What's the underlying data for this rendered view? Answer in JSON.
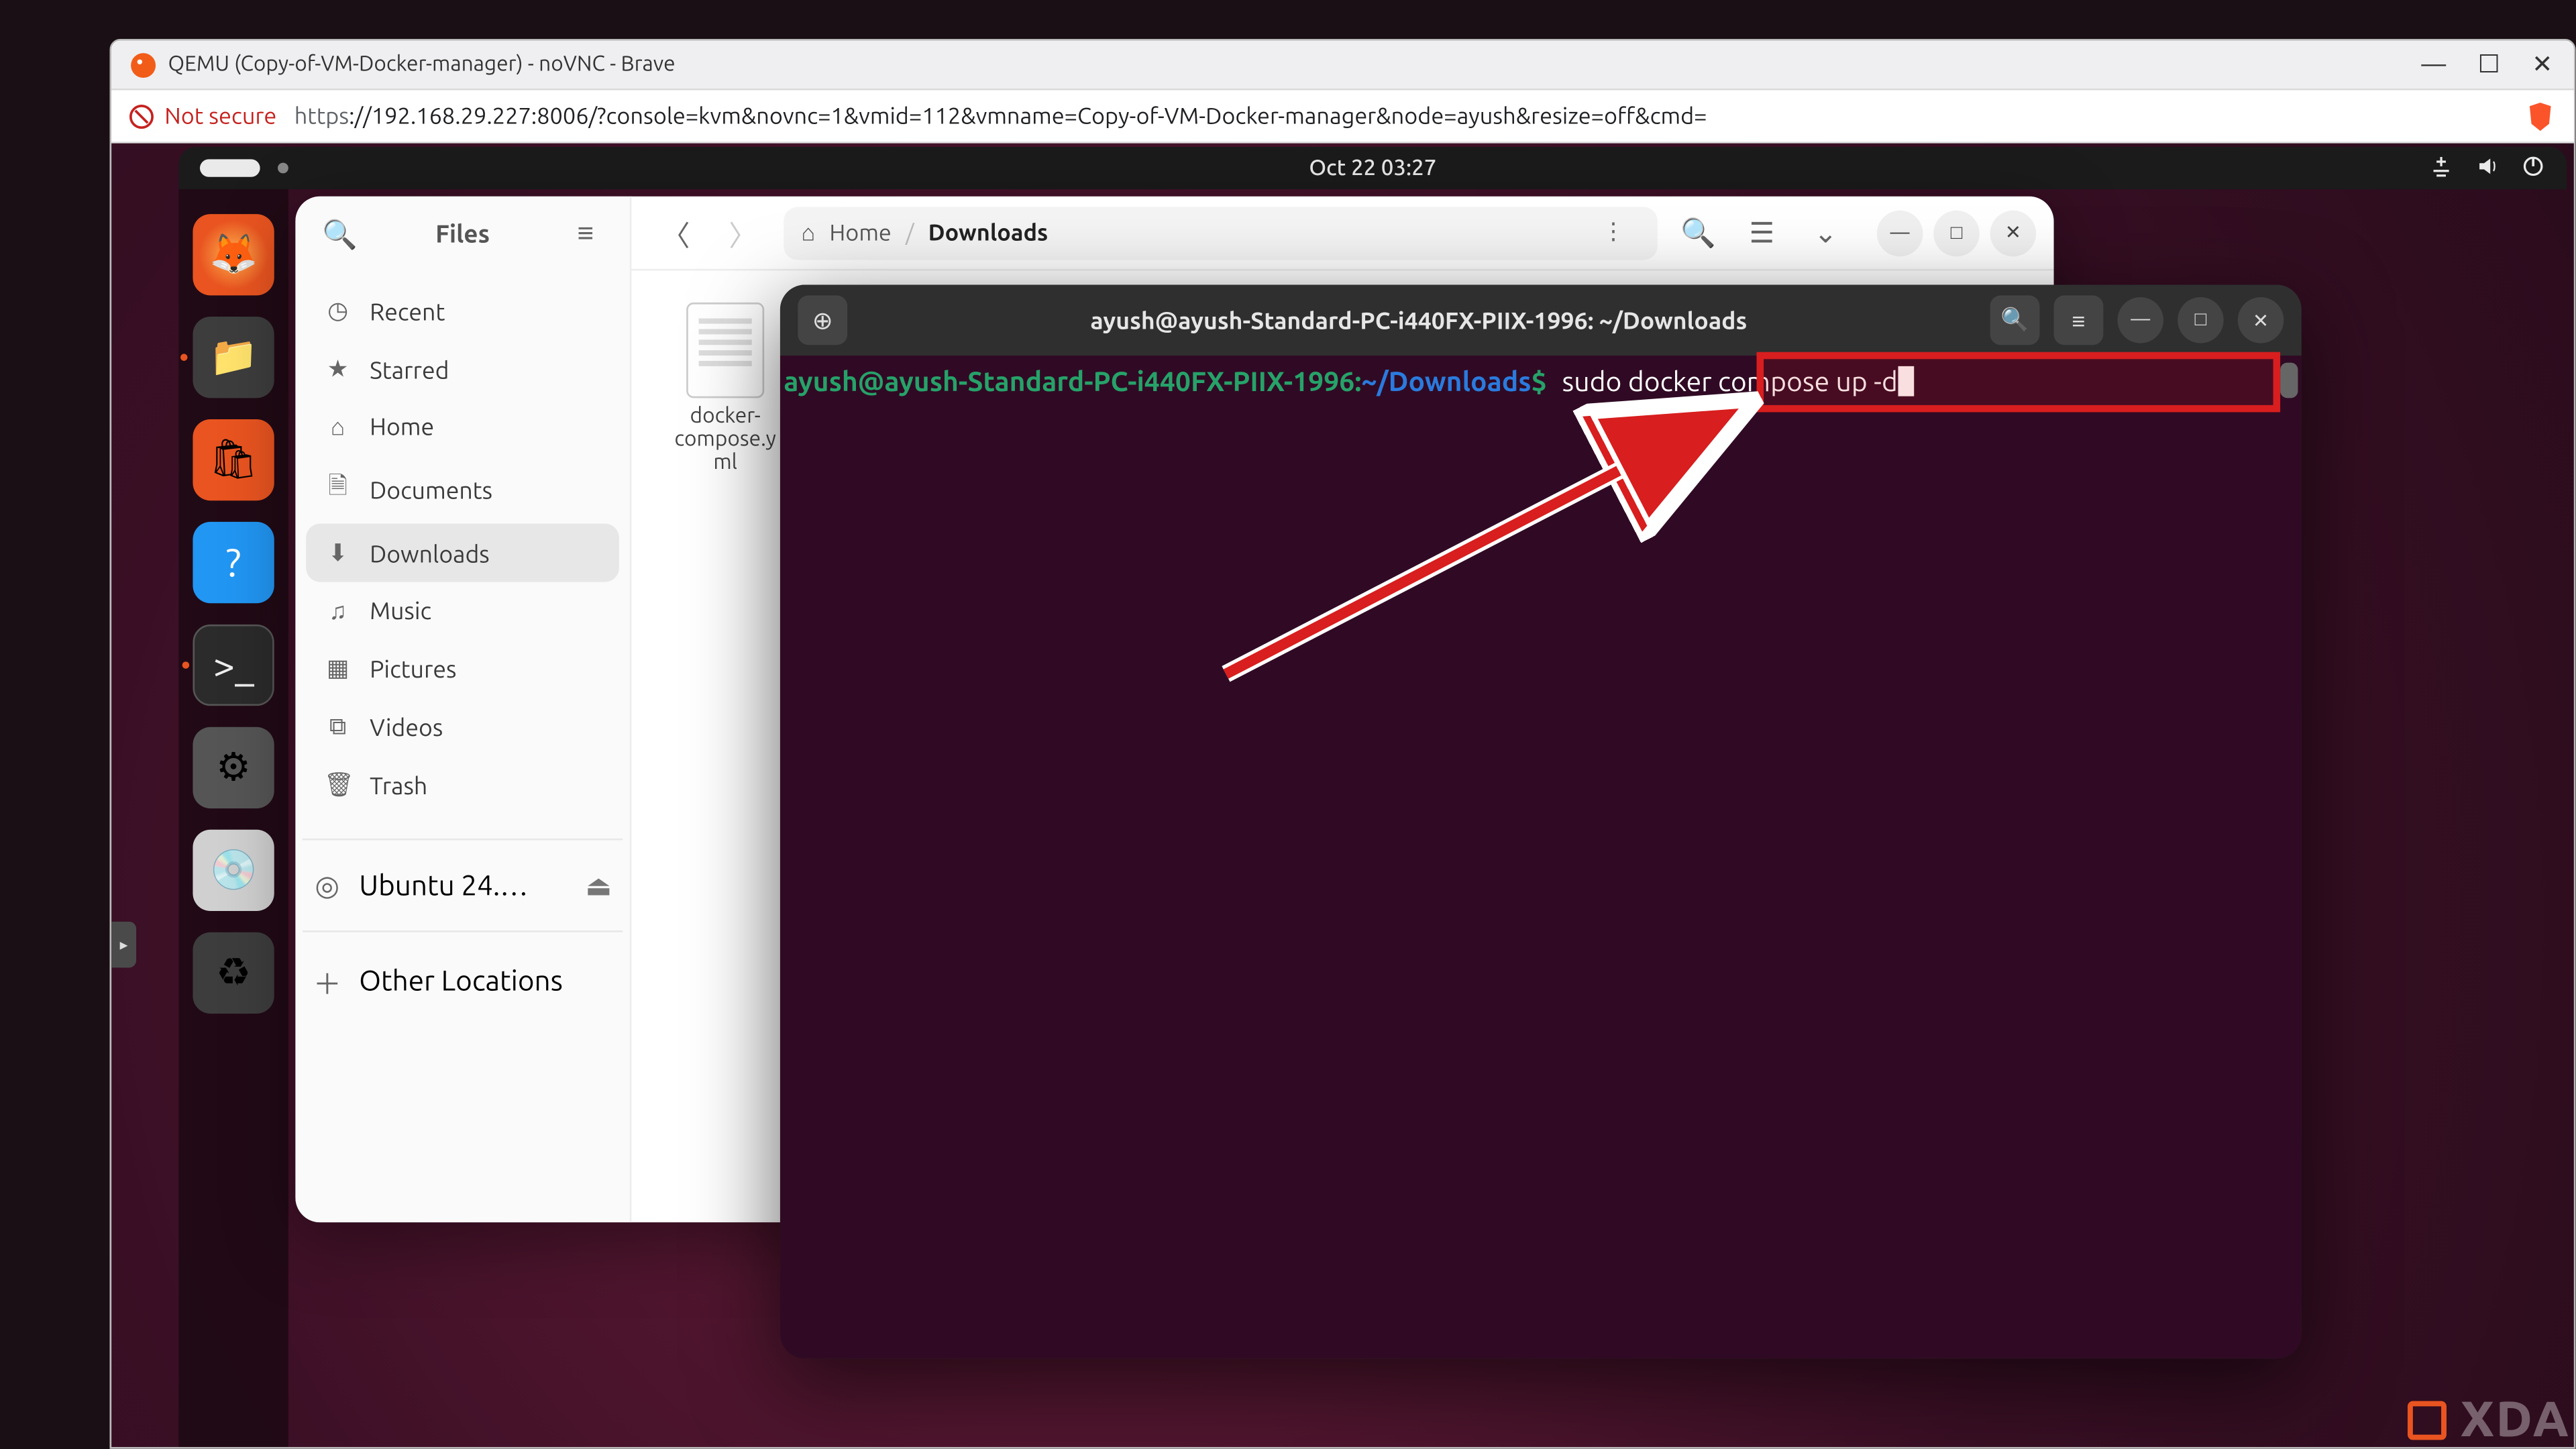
{
  "browser": {
    "title": "QEMU (Copy-of-VM-Docker-manager) - noVNC - Brave",
    "not_secure_label": "Not secure",
    "url_proto": "https",
    "url_rest": "://192.168.29.227:8006/?console=kvm&novnc=1&vmid=112&vmname=Copy-of-VM-Docker-manager&node=ayush&resize=off&cmd="
  },
  "gnome": {
    "clock": "Oct 22  03:27"
  },
  "dock": {
    "items": [
      {
        "name": "firefox"
      },
      {
        "name": "files"
      },
      {
        "name": "software"
      },
      {
        "name": "help"
      },
      {
        "name": "terminal"
      },
      {
        "name": "settings"
      },
      {
        "name": "disk"
      },
      {
        "name": "trash"
      }
    ]
  },
  "files": {
    "app_name": "Files",
    "path": {
      "root": "Home",
      "current": "Downloads"
    },
    "sidebar": [
      {
        "icon": "◷",
        "label": "Recent"
      },
      {
        "icon": "★",
        "label": "Starred"
      },
      {
        "icon": "⌂",
        "label": "Home"
      },
      {
        "icon": "🗎",
        "label": "Documents"
      },
      {
        "icon": "⬇",
        "label": "Downloads",
        "selected": true
      },
      {
        "icon": "♫",
        "label": "Music"
      },
      {
        "icon": "▦",
        "label": "Pictures"
      },
      {
        "icon": "⧉",
        "label": "Videos"
      },
      {
        "icon": "🗑",
        "label": "Trash"
      }
    ],
    "volumes": {
      "label": "Ubuntu 24.…"
    },
    "other": {
      "label": "Other Locations"
    },
    "file": {
      "lines": [
        "docker-",
        "compose.y",
        "ml"
      ]
    }
  },
  "terminal": {
    "title": "ayush@ayush-Standard-PC-i440FX-PIIX-1996: ~/Downloads",
    "prompt_user": "ayush@ayush-Standard-PC-i440FX-PIIX-1996",
    "prompt_sep": ":",
    "prompt_path": "~/Downloads",
    "prompt_dollar": "$",
    "command": "sudo docker compose up -d"
  },
  "watermark": "XDA"
}
